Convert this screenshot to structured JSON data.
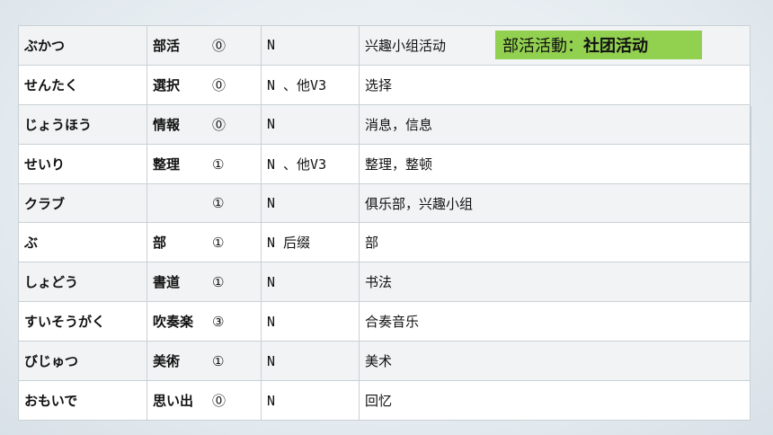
{
  "rows": [
    {
      "reading": "ぶかつ",
      "kanji": "部活",
      "accent": "⓪",
      "pos": "N",
      "meaning": "兴趣小组活动"
    },
    {
      "reading": "せんたく",
      "kanji": "選択",
      "accent": "⓪",
      "pos": "N 、他V3",
      "meaning": "选择"
    },
    {
      "reading": "じょうほう",
      "kanji": "情報",
      "accent": "⓪",
      "pos": "N",
      "meaning": "消息，信息"
    },
    {
      "reading": "せいり",
      "kanji": "整理",
      "accent": "①",
      "pos": "N 、他V3",
      "meaning": "整理，整顿"
    },
    {
      "reading": "クラブ",
      "kanji": "",
      "accent": "①",
      "pos": "N",
      "meaning": "俱乐部，兴趣小组"
    },
    {
      "reading": "ぶ",
      "kanji": "部",
      "accent": "①",
      "pos": "N 后缀",
      "meaning": "部"
    },
    {
      "reading": "しょどう",
      "kanji": "書道",
      "accent": "①",
      "pos": "N",
      "meaning": "书法"
    },
    {
      "reading": "すいそうがく",
      "kanji": "吹奏楽",
      "accent": "③",
      "pos": "N",
      "meaning": "合奏音乐"
    },
    {
      "reading": "びじゅつ",
      "kanji": "美術",
      "accent": "①",
      "pos": "N",
      "meaning": "美术"
    },
    {
      "reading": "おもいで",
      "kanji": "思い出",
      "accent": "⓪",
      "pos": "N",
      "meaning": "回忆"
    }
  ],
  "note": {
    "term": "部活活動：",
    "definition": "社团活动"
  },
  "colors": {
    "note_bg": "#92d050",
    "row_alt": "#f1f3f4",
    "border": "#c9d1d6"
  }
}
